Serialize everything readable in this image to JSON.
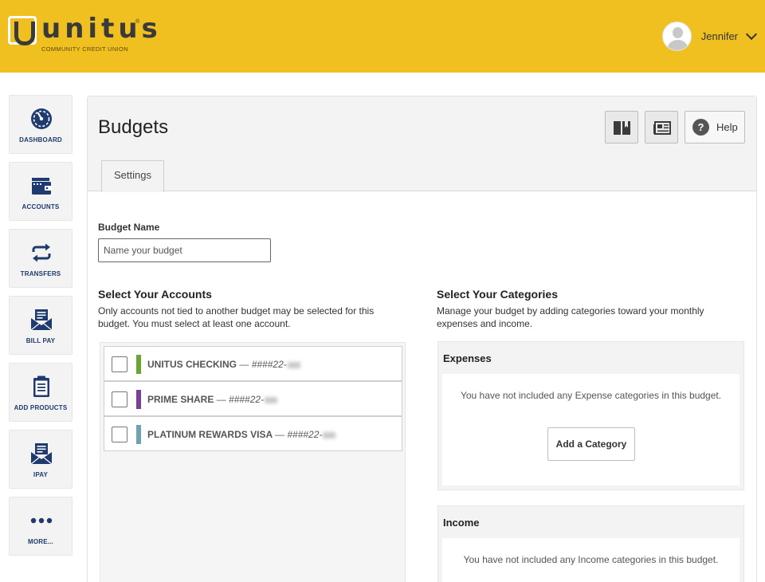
{
  "brand": {
    "name": "unitus",
    "registered": "®",
    "tagline": "COMMUNITY CREDIT UNION",
    "colors": {
      "header_bg": "#f0c020",
      "nav_blue": "#1e3a6e"
    }
  },
  "user": {
    "name": "Jennifer"
  },
  "sidebar": {
    "items": [
      {
        "label": "DASHBOARD",
        "icon": "gauge-icon"
      },
      {
        "label": "ACCOUNTS",
        "icon": "wallet-icon"
      },
      {
        "label": "TRANSFERS",
        "icon": "transfer-arrows-icon"
      },
      {
        "label": "BILL PAY",
        "icon": "envelope-bill-icon"
      },
      {
        "label": "ADD PRODUCTS",
        "icon": "clipboard-icon"
      },
      {
        "label": "IPAY",
        "icon": "envelope-pay-icon"
      },
      {
        "label": "MORE...",
        "icon": "more-dots-icon"
      }
    ]
  },
  "page": {
    "title": "Budgets",
    "help_label": "Help",
    "tabs": [
      {
        "label": "Settings"
      }
    ]
  },
  "form": {
    "budget_name_label": "Budget Name",
    "budget_name_placeholder": "Name your budget",
    "budget_name_value": ""
  },
  "accounts_section": {
    "title": "Select Your Accounts",
    "description": "Only accounts not tied to another budget may be selected for this budget. You must select at least one account.",
    "accounts": [
      {
        "name": "UNITUS CHECKING",
        "number": "####22-",
        "color": "#6aa533",
        "checked": false
      },
      {
        "name": "PRIME SHARE",
        "number": "####22-",
        "color": "#7b3f98",
        "checked": false
      },
      {
        "name": "PLATINUM REWARDS VISA",
        "number": "####22-",
        "color": "#6fa3b4",
        "checked": false
      }
    ]
  },
  "categories_section": {
    "title": "Select Your Categories",
    "description": "Manage your budget by adding categories toward your monthly expenses and income.",
    "expenses": {
      "title": "Expenses",
      "empty_text": "You have not included any Expense categories in this budget.",
      "add_label": "Add a Category"
    },
    "income": {
      "title": "Income",
      "empty_text": "You have not included any Income categories in this budget."
    }
  }
}
